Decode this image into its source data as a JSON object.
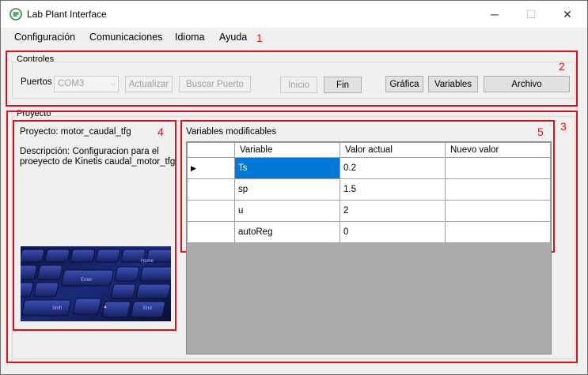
{
  "window": {
    "title": "Lab Plant Interface",
    "minimize_glyph": "─",
    "maximize_glyph": "☐",
    "close_glyph": "✕"
  },
  "menu": [
    "Configuración",
    "Comunicaciones",
    "Idioma",
    "Ayuda"
  ],
  "callouts": [
    "1",
    "2",
    "3",
    "4",
    "5"
  ],
  "controles": {
    "group_label": "Controles",
    "puertos_label": "Puertos",
    "port_value": "COM3",
    "actualizar": "Actualizar",
    "buscar_puerto": "Buscar Puerto",
    "inicio": "Inicio",
    "fin": "Fin",
    "grafica": "Gráfica",
    "variables": "Variables",
    "archivo": "Archivo"
  },
  "proyecto": {
    "group_label": "Proyecto",
    "name_line": "Proyecto: motor_caudal_tfg",
    "desc_line1": "Descripción: Configuracion para el",
    "desc_line2": "proeyecto de Kinetis caudal_motor_tfg"
  },
  "variables_panel": {
    "title": "Variables modificables",
    "columns": [
      "Variable",
      "Valor actual",
      "Nuevo valor"
    ],
    "rows": [
      {
        "variable": "Ts",
        "valor_actual": "0.2",
        "nuevo_valor": ""
      },
      {
        "variable": "sp",
        "valor_actual": "1.5",
        "nuevo_valor": ""
      },
      {
        "variable": "u",
        "valor_actual": "2",
        "nuevo_valor": ""
      },
      {
        "variable": "autoReg",
        "valor_actual": "0",
        "nuevo_valor": ""
      }
    ]
  },
  "colors": {
    "callout_red": "#e0101a",
    "selection_blue": "#0078d7",
    "grid_background": "#ababab"
  },
  "icons": [
    "app-icon",
    "current-row-indicator-icon",
    "combo-chevron-icon"
  ]
}
